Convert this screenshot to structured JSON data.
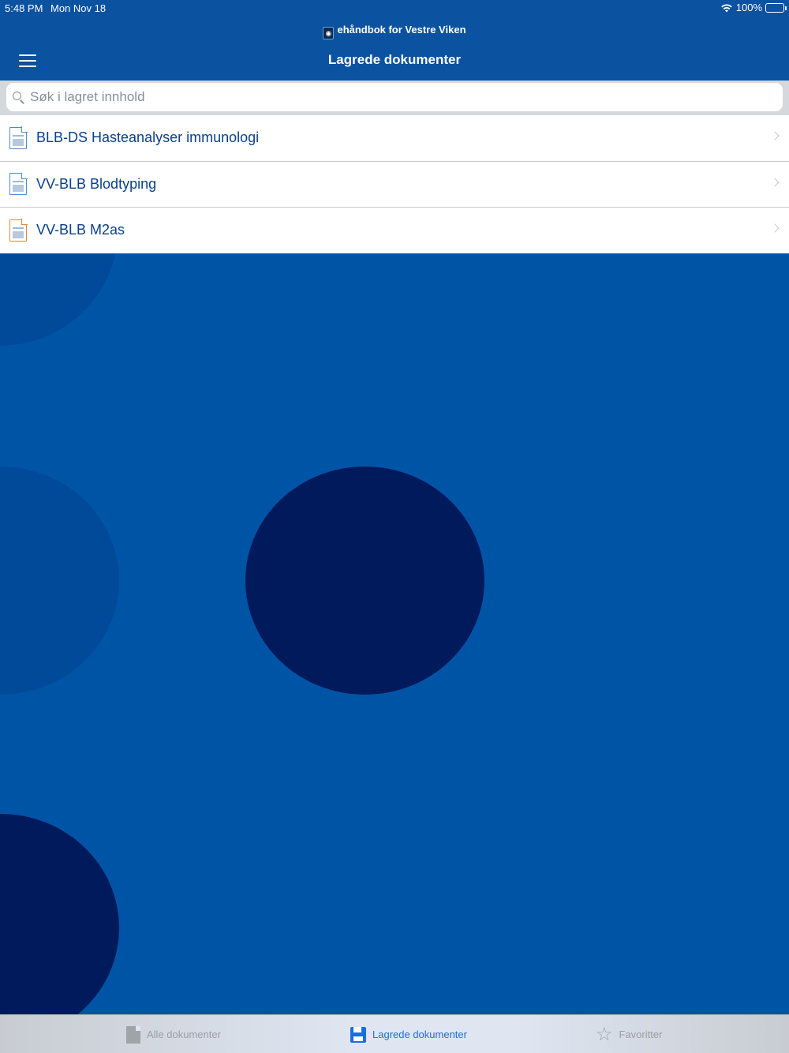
{
  "status": {
    "time": "5:48 PM",
    "date": "Mon Nov 18",
    "battery": "100%"
  },
  "app": {
    "title": "ehåndbok for Vestre Viken"
  },
  "header": {
    "title": "Lagrede dokumenter"
  },
  "search": {
    "placeholder": "Søk i lagret innhold"
  },
  "documents": [
    {
      "label": "BLB-DS Hasteanalyser immunologi",
      "icon": "document-blue-icon"
    },
    {
      "label": "VV-BLB Blodtyping",
      "icon": "document-blue-icon"
    },
    {
      "label": "VV-BLB M2as",
      "icon": "document-orange-icon"
    }
  ],
  "tabs": [
    {
      "label": "Alle dokumenter",
      "icon": "document-icon",
      "active": false
    },
    {
      "label": "Lagrede dokumenter",
      "icon": "save-icon",
      "active": true
    },
    {
      "label": "Favoritter",
      "icon": "star-icon",
      "active": false
    }
  ],
  "colors": {
    "header": "#0b52a0",
    "background": "#0054a6",
    "circle_mid": "#004a99",
    "circle_dark": "#001a5c",
    "accent": "#1a6fe0"
  }
}
